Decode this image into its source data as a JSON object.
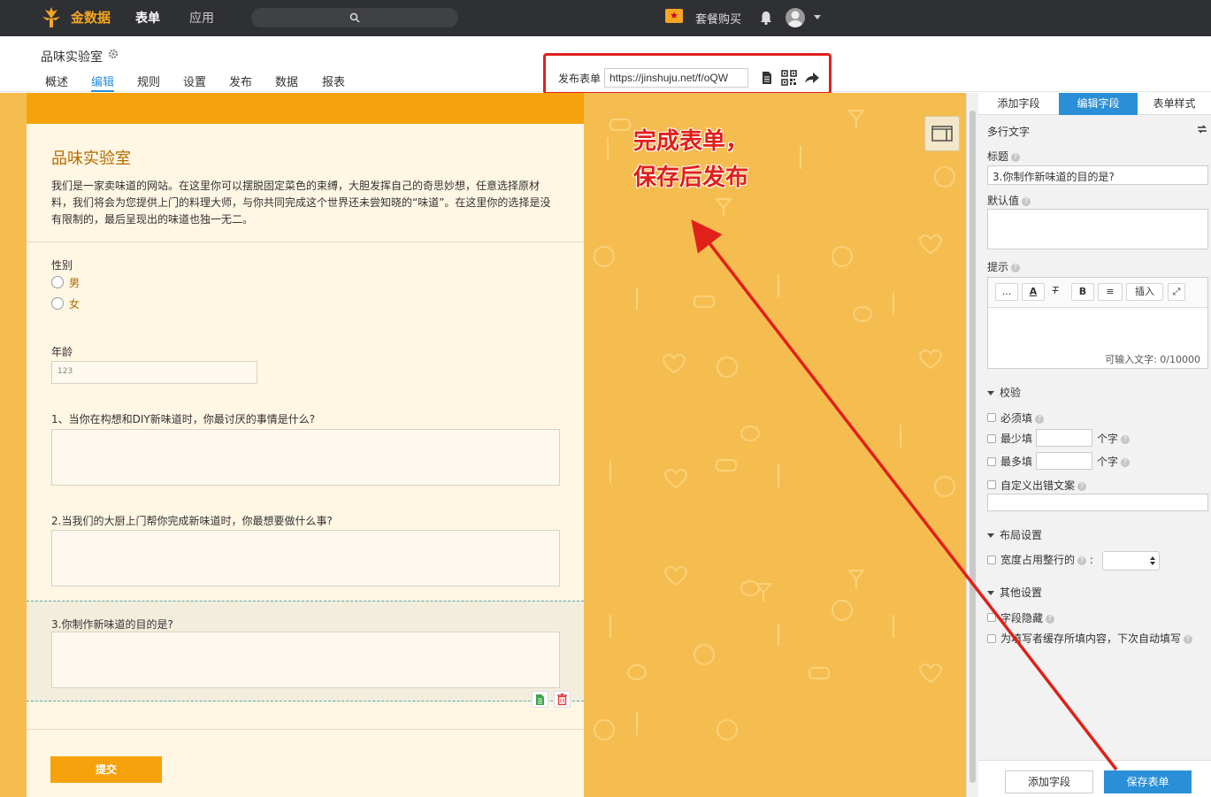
{
  "topbar": {
    "brand": "金数据",
    "nav": [
      "表单",
      "应用"
    ],
    "buy_plan": "套餐购买",
    "search_placeholder": ""
  },
  "header": {
    "form_name": "品味实验室",
    "tabs": [
      "概述",
      "编辑",
      "规则",
      "设置",
      "发布",
      "数据",
      "报表"
    ],
    "active_tab": "编辑"
  },
  "publish": {
    "label": "发布表单",
    "url": "https://jinshuju.net/f/oQW"
  },
  "annotation": "完成表单，保存后发布",
  "form": {
    "title": "品味实验室",
    "description": "我们是一家卖味道的网站。在这里你可以摆脱固定菜色的束缚，大胆发挥自己的奇思妙想，任意选择原材料，我们将会为您提供上门的料理大师，与你共同完成这个世界还未尝知晓的“味道”。在这里你的选择是没有限制的，最后呈现出的味道也独一无二。",
    "gender_label": "性别",
    "gender_options": [
      "男",
      "女"
    ],
    "age_label": "年龄",
    "age_hint": "123",
    "q1": "1、当你在构想和DIY新味道时，你最讨厌的事情是什么?",
    "q2": "2.当我们的大厨上门帮你完成新味道时，你最想要做什么事?",
    "q3": "3.你制作新味道的目的是?",
    "submit": "提交"
  },
  "side_panel": {
    "tabs": [
      "添加字段",
      "编辑字段",
      "表单样式"
    ],
    "active_tab": "编辑字段",
    "field_type": "多行文字",
    "title_label": "标题",
    "title_value": "3.你制作新味道的目的是?",
    "default_label": "默认值",
    "hint_label": "提示",
    "toolbar": {
      "more": "...",
      "insert": "插入"
    },
    "char_count": "可输入文字: 0/10000",
    "validation": {
      "heading": "校验",
      "required": "必须填",
      "min": "最少填",
      "max": "最多填",
      "unit": "个字",
      "custom_error": "自定义出错文案"
    },
    "layout": {
      "heading": "布局设置",
      "width_label": "宽度占用整行的",
      "colon": ":"
    },
    "other": {
      "heading": "其他设置",
      "hide_field": "字段隐藏",
      "cache": "为填写者缓存所填内容，下次自动填写"
    },
    "footer": {
      "add_field": "添加字段",
      "save": "保存表单"
    }
  },
  "colors": {
    "accent": "#2a8fd6",
    "brand": "#f5a623",
    "canvas_bg": "#f5bd4f",
    "annotation": "#e0201a"
  }
}
